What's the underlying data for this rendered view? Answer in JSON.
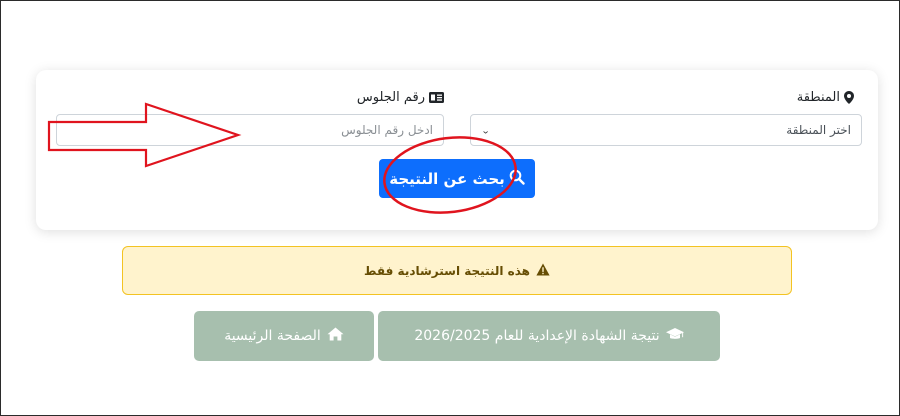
{
  "form": {
    "region_label": "المنطقة",
    "region_select_value": "اختر المنطقة",
    "seat_label": "رقم الجلوس",
    "seat_placeholder": "ادخل رقم الجلوس",
    "search_button": "بحث عن النتيجة"
  },
  "alert": {
    "text": "هذه النتيجة استرشادية فقط"
  },
  "nav": {
    "result_button": "نتيجة الشهادة الإعدادية للعام 2026/2025",
    "home_button": "الصفحة الرئيسية"
  },
  "icons": {
    "region": "map-marker-icon",
    "seat": "id-card-icon",
    "search": "search-icon",
    "alert": "warning-icon",
    "result": "graduation-cap-icon",
    "home": "home-icon"
  },
  "colors": {
    "primary": "#0d6efd",
    "alert_bg": "#fff3cd",
    "alert_border": "#f3c322",
    "muted_button": "#a7bfae",
    "annotation": "#e0141e"
  }
}
